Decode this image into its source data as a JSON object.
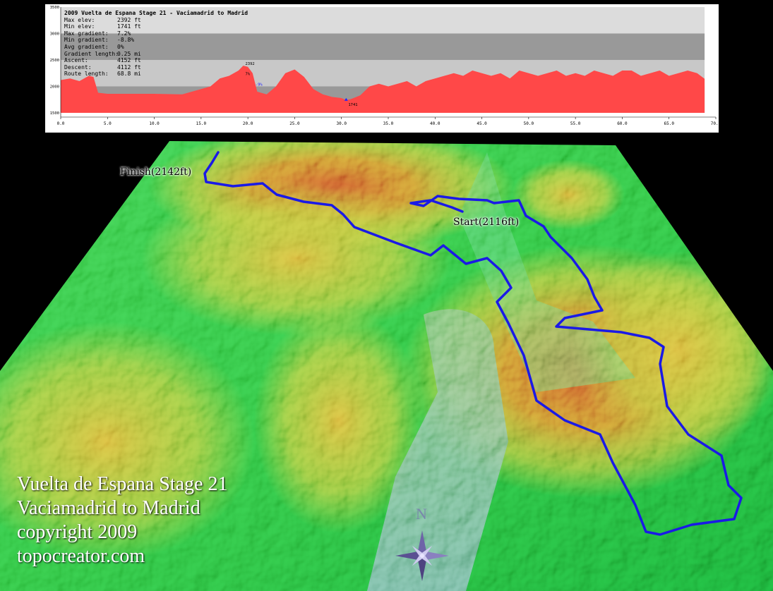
{
  "profile": {
    "title": "2009 Vuelta de Espana Stage 21 - Vaciamadrid to Madrid",
    "stats": [
      {
        "label": "Max elev:",
        "value": "2392 ft"
      },
      {
        "label": "Min elev:",
        "value": "1741 ft"
      },
      {
        "label": "Max gradient:",
        "value": "7.2%"
      },
      {
        "label": "Min gradient:",
        "value": "-8.8%"
      },
      {
        "label": "Avg gradient:",
        "value": "0%"
      },
      {
        "label": "Gradient length:",
        "value": "0.25 mi"
      },
      {
        "label": "Ascent:",
        "value": "4152 ft"
      },
      {
        "label": "Descent:",
        "value": "4112 ft"
      },
      {
        "label": "Route length:",
        "value": "68.8 mi"
      }
    ],
    "peak_label": "2392",
    "peak_grade": "7%",
    "steep_grade": "-9%",
    "min_label": "1741",
    "fill_color": "#ff4848",
    "band_colors": [
      "#dcdcdc",
      "#999999",
      "#c8c8c8"
    ]
  },
  "chart_data": {
    "type": "area",
    "title": "2009 Vuelta de Espana Stage 21 - Vaciamadrid to Madrid",
    "xlabel": "",
    "ylabel": "",
    "xlim": [
      0,
      70
    ],
    "ylim": [
      1500,
      3500
    ],
    "x_ticks": [
      "0.0",
      "5.0",
      "10.0",
      "15.0",
      "20.0",
      "25.0",
      "30.0",
      "35.0",
      "40.0",
      "45.0",
      "50.0",
      "55.0",
      "60.0",
      "65.0",
      "70.0"
    ],
    "y_ticks": [
      "1500",
      "2000",
      "2500",
      "3000",
      "3500"
    ],
    "series": [
      {
        "x": [
          0,
          1,
          2,
          3,
          3.5,
          4,
          5,
          7,
          10,
          13,
          16,
          17,
          18,
          19,
          19.5,
          20,
          20.5,
          21,
          22,
          23,
          24,
          25,
          26,
          27,
          28,
          29,
          30,
          30.5,
          31,
          32,
          33,
          34,
          35,
          36,
          37,
          38,
          39,
          40,
          41,
          42,
          43,
          44,
          45,
          46,
          47,
          48,
          49,
          50,
          51,
          52,
          53,
          54,
          55,
          56,
          57,
          58,
          59,
          60,
          61,
          62,
          63,
          64,
          65,
          66,
          67,
          68,
          68.8
        ],
        "y": [
          2120,
          2150,
          2100,
          2200,
          2180,
          1880,
          1860,
          1860,
          1860,
          1850,
          2000,
          2150,
          2200,
          2300,
          2392,
          2370,
          2250,
          1900,
          1850,
          2000,
          2250,
          2320,
          2180,
          1950,
          1850,
          1800,
          1780,
          1741,
          1760,
          1830,
          2000,
          2050,
          2000,
          2050,
          2100,
          2000,
          2100,
          2150,
          2200,
          2250,
          2200,
          2300,
          2250,
          2200,
          2250,
          2150,
          2300,
          2250,
          2200,
          2250,
          2300,
          2200,
          2250,
          2200,
          2300,
          2250,
          2200,
          2300,
          2300,
          2200,
          2250,
          2300,
          2200,
          2250,
          2300,
          2250,
          2142
        ]
      }
    ],
    "annotations": [
      "2392",
      "7%",
      "-9%",
      "1741"
    ]
  },
  "map": {
    "finish_label": "Finish(2142ft)",
    "start_label": "Start(2116ft)",
    "north_label": "N",
    "caption_lines": [
      "Vuelta de Espana Stage 21",
      "Vaciamadrid to Madrid",
      "copyright 2009",
      "topocreator.com"
    ],
    "route_color": "#1a1ae6",
    "icons": [
      "compass-rose-icon"
    ]
  }
}
